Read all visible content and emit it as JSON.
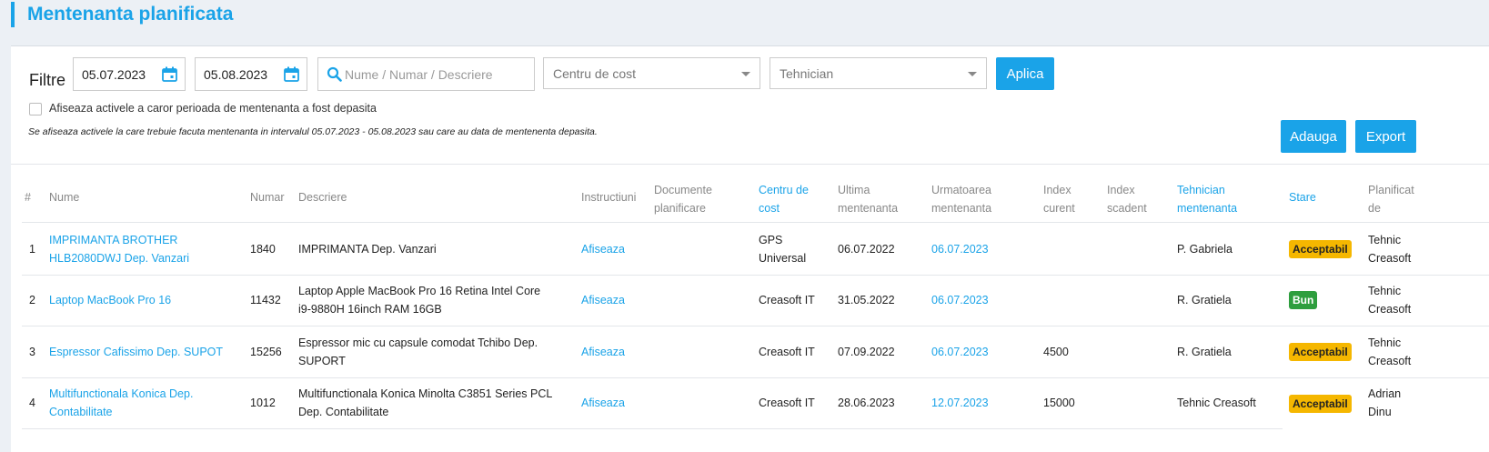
{
  "page": {
    "title": "Mentenanta planificata"
  },
  "filters": {
    "label": "Filtre",
    "date_from": "05.07.2023",
    "date_to": "05.08.2023",
    "search_placeholder": "Nume / Numar / Descriere",
    "cost_center_placeholder": "Centru de cost",
    "technician_placeholder": "Tehnician",
    "apply_label": "Aplica",
    "overdue_checkbox_label": "Afiseaza activele a caror perioada de mentenanta a fost depasita",
    "overdue_checked": false,
    "note": "Se afiseaza activele la care trebuie facuta mentenanta in intervalul 05.07.2023 - 05.08.2023 sau care au data de mentenenta depasita."
  },
  "actions": {
    "add_label": "Adauga",
    "export_label": "Export"
  },
  "table": {
    "headers": {
      "idx": "#",
      "name": "Nume",
      "number": "Numar",
      "description": "Descriere",
      "instructions": "Instructiuni",
      "docs_1": "Documente",
      "docs_2": "planificare",
      "cost_1": "Centru de",
      "cost_2": "cost",
      "last_1": "Ultima",
      "last_2": "mentenanta",
      "next_1": "Urmatoarea",
      "next_2": "mentenanta",
      "idx_cur_1": "Index",
      "idx_cur_2": "curent",
      "idx_due_1": "Index",
      "idx_due_2": "scadent",
      "tech_1": "Tehnician",
      "tech_2": "mentenanta",
      "state": "Stare",
      "planned_1": "Planificat",
      "planned_2": "de"
    },
    "rows": [
      {
        "idx": "1",
        "name_1": "IMPRIMANTA BROTHER",
        "name_2": "HLB2080DWJ Dep. Vanzari",
        "number": "1840",
        "desc_1": "IMPRIMANTA Dep. Vanzari",
        "desc_2": "",
        "instructions": "Afiseaza",
        "cost_1": "GPS",
        "cost_2": "Universal",
        "last": "06.07.2022",
        "next": "06.07.2023",
        "index_current": "",
        "technician": "P. Gabriela",
        "state": "Acceptabil",
        "planned_1": "Tehnic",
        "planned_2": "Creasoft"
      },
      {
        "idx": "2",
        "name_1": "Laptop MacBook Pro 16",
        "name_2": "",
        "number": "11432",
        "desc_1": "Laptop Apple MacBook Pro 16 Retina Intel Core",
        "desc_2": "i9-9880H 16inch RAM 16GB",
        "instructions": "Afiseaza",
        "cost_1": "Creasoft IT",
        "cost_2": "",
        "last": "31.05.2022",
        "next": "06.07.2023",
        "index_current": "",
        "technician": "R. Gratiela",
        "state": "Bun",
        "planned_1": "Tehnic",
        "planned_2": "Creasoft"
      },
      {
        "idx": "3",
        "name_1": "Espressor Cafissimo Dep. SUPOT",
        "name_2": "",
        "number": "15256",
        "desc_1": "Espressor mic cu capsule comodat Tchibo Dep.",
        "desc_2": "SUPORT",
        "instructions": "Afiseaza",
        "cost_1": "Creasoft IT",
        "cost_2": "",
        "last": "07.09.2022",
        "next": "06.07.2023",
        "index_current": "4500",
        "technician": "R. Gratiela",
        "state": "Acceptabil",
        "planned_1": "Tehnic",
        "planned_2": "Creasoft"
      },
      {
        "idx": "4",
        "name_1": "Multifunctionala Konica Dep.",
        "name_2": "Contabilitate",
        "number": "1012",
        "desc_1": "Multifunctionala Konica Minolta C3851 Series PCL",
        "desc_2": "Dep. Contabilitate",
        "instructions": "Afiseaza",
        "cost_1": "Creasoft IT",
        "cost_2": "",
        "last": "28.06.2023",
        "next": "12.07.2023",
        "index_current": "15000",
        "technician": "Tehnic Creasoft",
        "state": "Acceptabil",
        "planned_1": "Adrian",
        "planned_2": "Dinu"
      }
    ]
  },
  "colors": {
    "accent": "#1aa3e8",
    "warn": "#f5b700",
    "ok": "#2e9e3e"
  }
}
